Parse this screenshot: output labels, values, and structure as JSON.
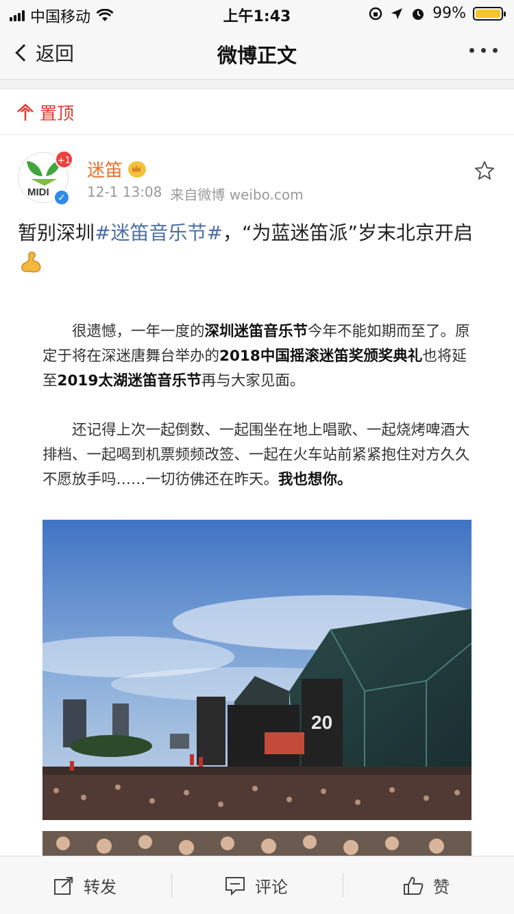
{
  "status_bar": {
    "carrier": "中国移动",
    "time": "上午1:43",
    "battery": "99%",
    "battery_level": 0.99
  },
  "nav": {
    "back_label": "返回",
    "title": "微博正文"
  },
  "pinned": {
    "label": "置顶"
  },
  "post": {
    "author": {
      "name": "迷笛",
      "badge_count": "+1",
      "avatar_text": "MIDI"
    },
    "time": "12-1 13:08",
    "source": "来自微博 weibo.com",
    "text_before": "暂别深圳",
    "hashtag": "#迷笛音乐节#",
    "text_after": "，“为蓝迷笛派”岁末北京开启"
  },
  "long_text": {
    "p1": {
      "s1": "很遗憾，一年一度的",
      "b1": "深圳迷笛音乐节",
      "s2": "今年不能如期而至了。原定于将在深迷唐舞台举办的",
      "b2": "2018中国摇滚迷笛奖颁奖典礼",
      "s3": "也将延至",
      "b3": "2019太湖迷笛音乐节",
      "s4": "再与大家见面。"
    },
    "p2": {
      "s1": "还记得上次一起倒数、一起围坐在地上唱歌、一起烧烤啤酒大排档、一起喝到机票频频改签、一起在火车站前紧紧抱住对方久久不愿放手吗……一切彷佛还在昨天。",
      "b1": "我也想你。"
    }
  },
  "photo": {
    "stage_logo": "20"
  },
  "actions": {
    "repost": "转发",
    "comment": "评论",
    "like": "赞"
  }
}
